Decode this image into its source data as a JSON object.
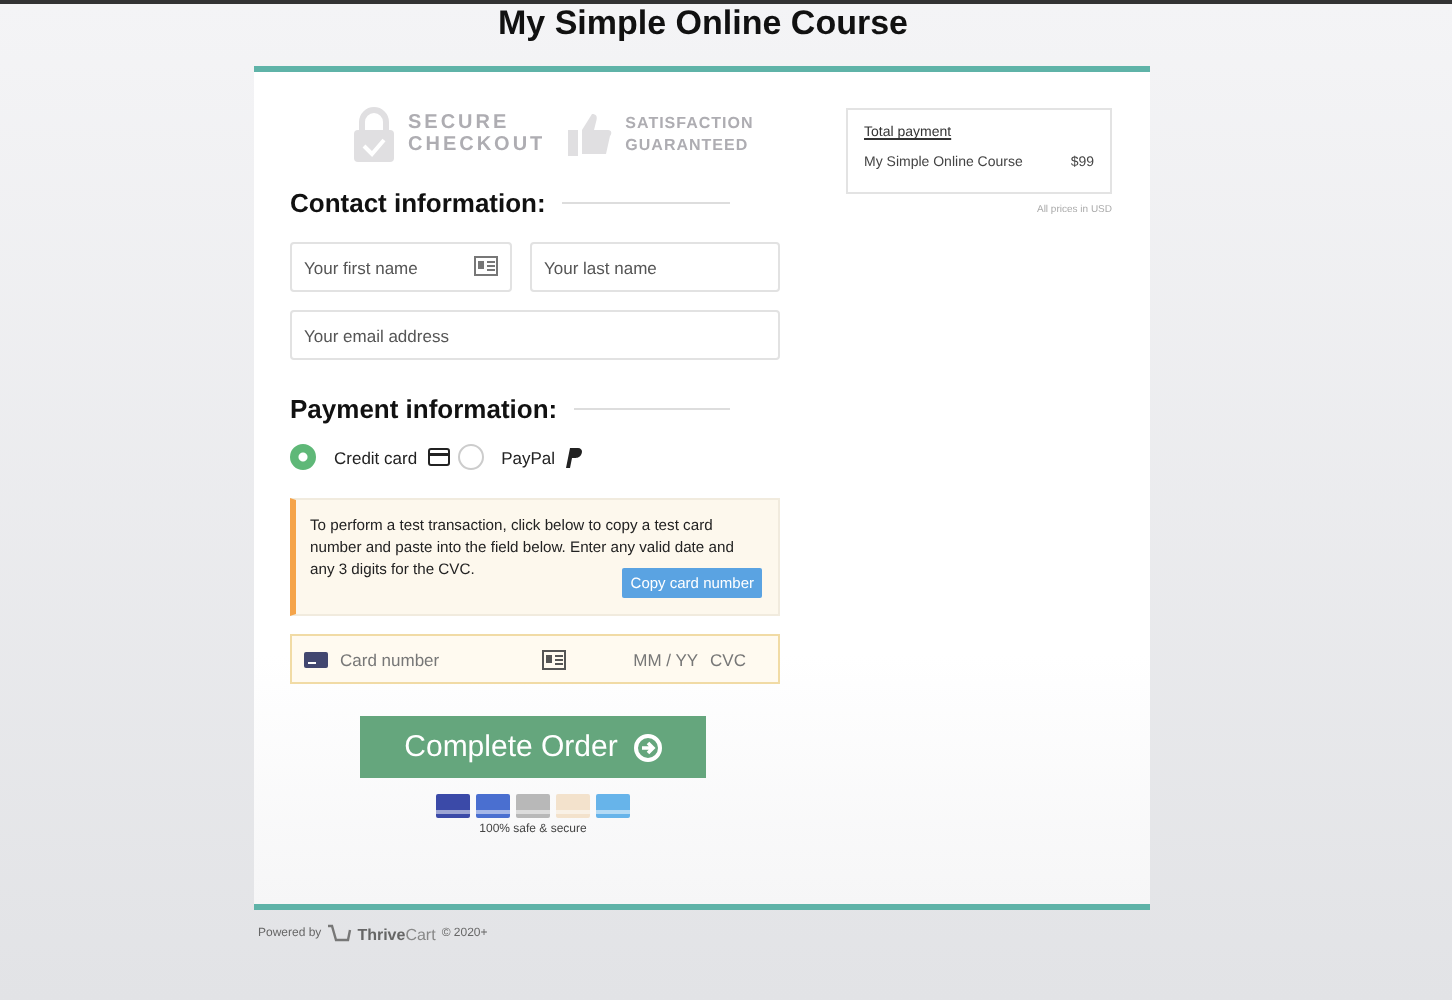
{
  "page_title": "My Simple Online Course",
  "badges": [
    {
      "kind": "lock",
      "lines": [
        "SECURE",
        "CHECKOUT"
      ]
    },
    {
      "kind": "thumb",
      "lines": [
        "SATISFACTION",
        "GUARANTEED"
      ]
    }
  ],
  "contact": {
    "heading": "Contact information:",
    "first_name": {
      "placeholder": "Your first name"
    },
    "last_name": {
      "placeholder": "Your last name"
    },
    "email": {
      "placeholder": "Your email address"
    }
  },
  "payment": {
    "heading": "Payment information:",
    "methods": [
      {
        "label": "Credit card",
        "kind": "card",
        "selected": true
      },
      {
        "label": "PayPal",
        "kind": "paypal",
        "selected": false
      }
    ],
    "notice": "To perform a test transaction, click below to copy a test card number and paste into the field below. Enter any valid date and any 3 digits for the CVC.",
    "copy_button": "Copy card number",
    "card_field": {
      "placeholder": "Card number",
      "expiry_placeholder": "MM / YY",
      "cvc_placeholder": "CVC"
    }
  },
  "submit_button": "Complete Order",
  "secure_note": "100% safe & secure",
  "summary": {
    "title": "Total payment",
    "items": [
      {
        "name": "My Simple Online Course",
        "price": "$99"
      }
    ],
    "note": "All prices in USD"
  },
  "footer": {
    "powered_by": "Powered by",
    "brand_bold": "Thrive",
    "brand_light": "Cart",
    "copyright": "© 2020+"
  }
}
